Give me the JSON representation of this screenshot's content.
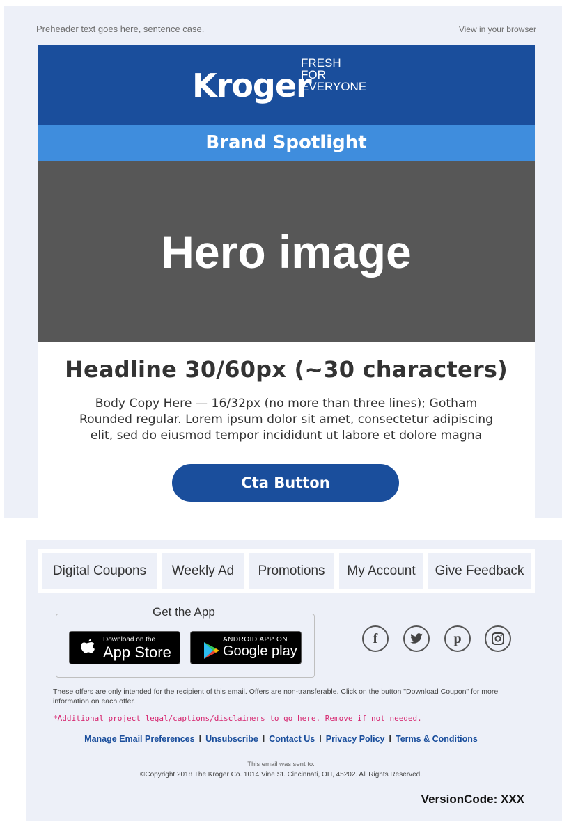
{
  "preheader": {
    "text": "Preheader text goes here, sentence case.",
    "view_in_browser": "View in your browser"
  },
  "header": {
    "logo_text": "Kroger",
    "tagline": [
      "FRESH",
      "FOR",
      "EVERYONE"
    ],
    "brand_color": "#1a4e9c"
  },
  "spotlight": {
    "label": "Brand Spotlight",
    "color": "#3f8ddd"
  },
  "hero": {
    "label": "Hero image",
    "color": "#575757"
  },
  "content": {
    "headline": "Headline 30/60px (~30 characters)",
    "body_lines": [
      "Body Copy Here — 16/32px (no more than three lines); Gotham",
      "Rounded regular. Lorem ipsum dolor sit amet, consectetur adipiscing",
      "elit, sed do eiusmod tempor incididunt ut labore et dolore magna"
    ],
    "cta_label": "Cta Button"
  },
  "nav": {
    "items": [
      {
        "label": "Digital Coupons"
      },
      {
        "label": "Weekly Ad"
      },
      {
        "label": "Promotions"
      },
      {
        "label": "My Account"
      },
      {
        "label": "Give Feedback"
      }
    ]
  },
  "app": {
    "title": "Get the App",
    "app_store": {
      "small": "Download on the",
      "big": "App Store",
      "icon": "apple-icon"
    },
    "google_play": {
      "small": "ANDROID APP ON",
      "big": "Google play",
      "icon": "google-play-icon"
    }
  },
  "social": [
    {
      "icon": "facebook-icon",
      "glyph": "f"
    },
    {
      "icon": "twitter-icon",
      "glyph": ""
    },
    {
      "icon": "pinterest-icon",
      "glyph": "p"
    },
    {
      "icon": "instagram-icon",
      "glyph": ""
    }
  ],
  "footer": {
    "legal": "These offers are only intended for the recipient of this email. Offers are non-transferable. Click on the button \"Download Coupon\" for more information on each offer.",
    "disclaimer": "*Additional project legal/captions/disclaimers to go here. Remove if not needed.",
    "links": [
      "Manage Email Preferences",
      "Unsubscribe",
      "Contact Us",
      "Privacy Policy",
      "Terms & Conditions"
    ],
    "link_separator": "I",
    "sent_to": "This email was sent to:",
    "copyright": "©Copyright 2018 The Kroger Co. 1014 Vine St. Cincinnati, OH, 45202. All Rights Reserved.",
    "version": "VersionCode: XXX"
  }
}
